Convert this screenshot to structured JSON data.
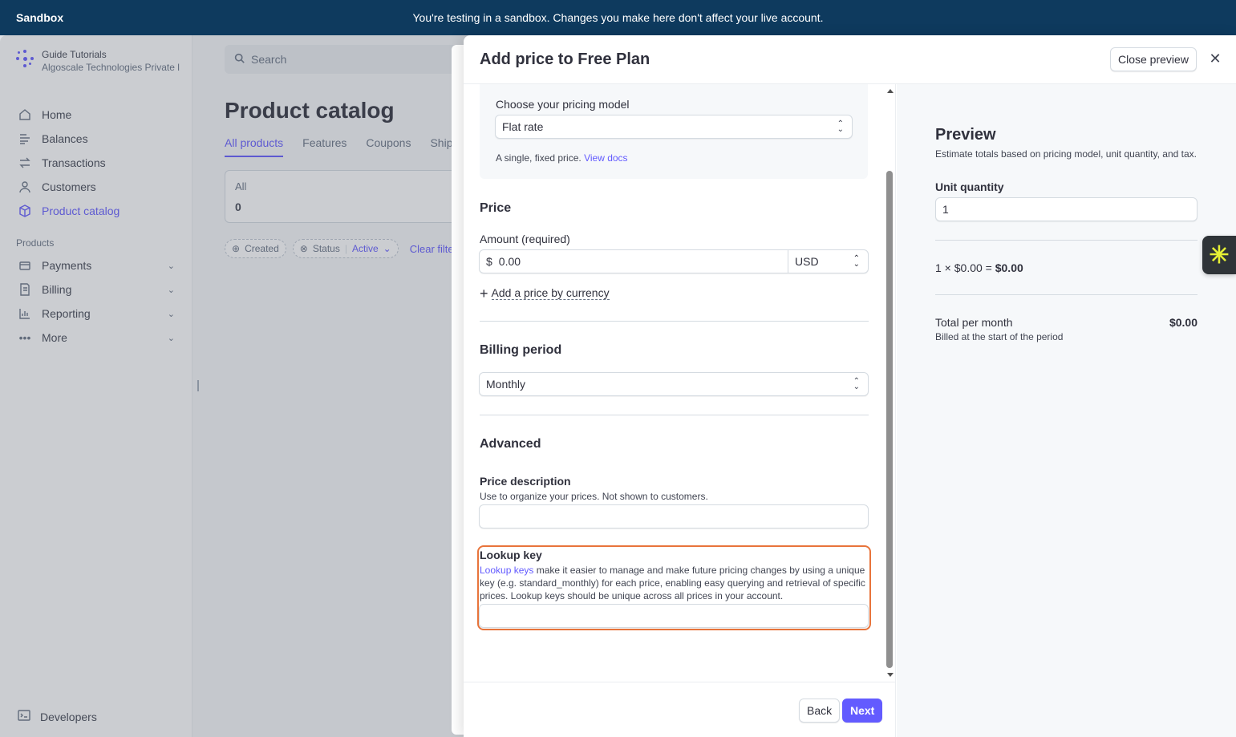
{
  "banner": {
    "tag": "Sandbox",
    "message": "You're testing in a sandbox. Changes you make here don't affect your live account."
  },
  "account": {
    "name": "Guide Tutorials",
    "company": "Algoscale Technologies Private l"
  },
  "sidebar": {
    "items": [
      {
        "label": "Home",
        "icon": "home-icon"
      },
      {
        "label": "Balances",
        "icon": "balances-icon"
      },
      {
        "label": "Transactions",
        "icon": "transactions-icon"
      },
      {
        "label": "Customers",
        "icon": "customers-icon"
      },
      {
        "label": "Product catalog",
        "icon": "product-catalog-icon"
      }
    ],
    "products_section": "Products",
    "product_items": [
      {
        "label": "Payments",
        "icon": "payments-icon"
      },
      {
        "label": "Billing",
        "icon": "billing-icon"
      },
      {
        "label": "Reporting",
        "icon": "reporting-icon"
      },
      {
        "label": "More",
        "icon": "more-icon"
      }
    ],
    "developers": "Developers"
  },
  "main": {
    "search_placeholder": "Search",
    "title": "Product catalog",
    "tabs": [
      "All products",
      "Features",
      "Coupons",
      "Ship"
    ],
    "all_card": {
      "label": "All",
      "count": "0"
    },
    "filters": {
      "created": "Created",
      "status": "Status",
      "status_value": "Active",
      "clear": "Clear filte"
    }
  },
  "drawer": {
    "title": "Add price to Free Plan",
    "close_preview": "Close preview",
    "pricing_model": {
      "label": "Choose your pricing model",
      "value": "Flat rate",
      "help": "A single, fixed price.",
      "help_link": "View docs"
    },
    "price": {
      "heading": "Price",
      "amount_label": "Amount (required)",
      "currency_symbol": "$",
      "amount_value": "0.00",
      "currency": "USD",
      "add_currency": "Add a price by currency"
    },
    "billing": {
      "heading": "Billing period",
      "value": "Monthly"
    },
    "advanced": {
      "heading": "Advanced",
      "desc_label": "Price description",
      "desc_help": "Use to organize your prices. Not shown to customers.",
      "desc_value": "",
      "lookup_label": "Lookup key",
      "lookup_link": "Lookup keys",
      "lookup_help": " make it easier to manage and make future pricing changes by using a unique key (e.g. standard_monthly) for each price, enabling easy querying and retrieval of specific prices. Lookup keys should be unique across all prices in your account.",
      "lookup_value": ""
    },
    "back": "Back",
    "next": "Next"
  },
  "preview": {
    "title": "Preview",
    "subtitle": "Estimate totals based on pricing model, unit quantity, and tax.",
    "unit_label": "Unit quantity",
    "unit_value": "1",
    "calc_prefix": "1 × $0.00 = ",
    "calc_total": "$0.00",
    "total_label": "Total per month",
    "total_value": "$0.00",
    "billed_note": "Billed at the start of the period"
  },
  "colors": {
    "accent": "#635bff",
    "banner": "#0e3a5e",
    "highlight": "#e8743b"
  }
}
